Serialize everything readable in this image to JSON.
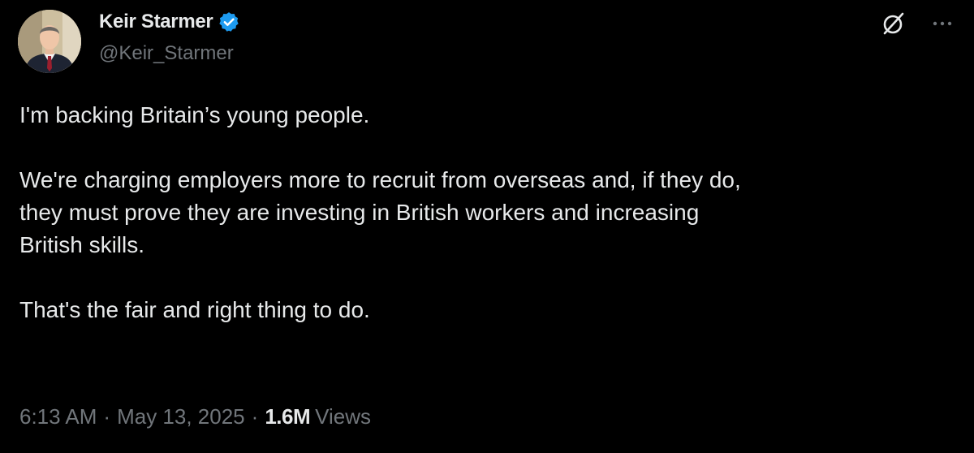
{
  "author": {
    "display_name": "Keir Starmer",
    "handle": "@Keir_Starmer",
    "verified": true,
    "verified_badge_color": "#1d9bf0"
  },
  "actions": {
    "grok_icon": "grok-icon",
    "more_icon": "more-icon"
  },
  "tweet": {
    "paragraphs": [
      "I'm backing Britain’s young people.",
      "We're charging employers more to recruit from overseas and, if they do,\nthey must prove they are investing in British workers and increasing\nBritish skills.",
      "That's the fair and right thing to do."
    ]
  },
  "meta": {
    "time": "6:13 AM",
    "separator": "·",
    "date": "May 13, 2025",
    "views_count": "1.6M",
    "views_label": "Views"
  },
  "colors": {
    "background": "#000000",
    "text_primary": "#e7e9ea",
    "text_secondary": "#71767b",
    "accent": "#1d9bf0"
  }
}
